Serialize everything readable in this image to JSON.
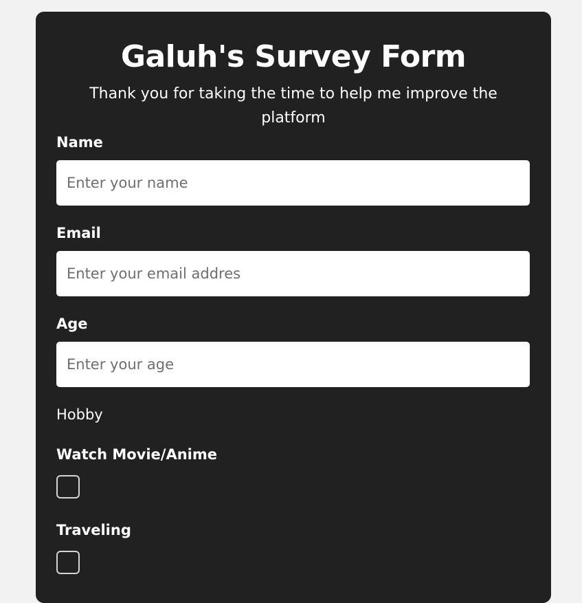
{
  "form": {
    "title": "Galuh's Survey Form",
    "description": "Thank you for taking the time to help me improve the platform",
    "name": {
      "label": "Name",
      "placeholder": "Enter your name",
      "value": ""
    },
    "email": {
      "label": "Email",
      "placeholder": "Enter your email addres",
      "value": ""
    },
    "age": {
      "label": "Age",
      "placeholder": "Enter your age",
      "value": ""
    },
    "hobby": {
      "label": "Hobby",
      "options": [
        {
          "label": "Watch Movie/Anime",
          "checked": false
        },
        {
          "label": "Traveling",
          "checked": false
        }
      ]
    }
  },
  "colors": {
    "page_background": "#f2f2f2",
    "card_background": "#212121",
    "text": "#ffffff",
    "input_background": "#ffffff",
    "placeholder": "#6e6e6e",
    "checkbox_border": "#d4d4d4"
  }
}
